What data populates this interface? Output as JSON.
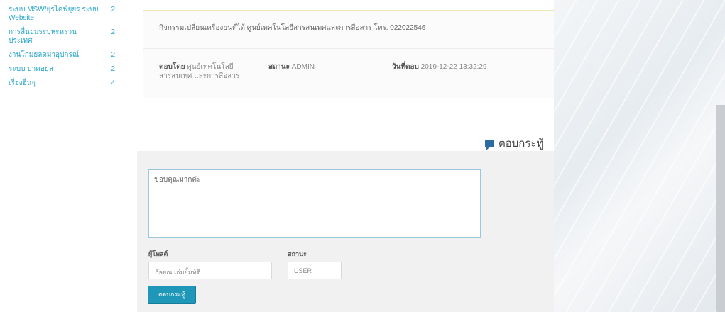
{
  "sidebar": {
    "items": [
      {
        "label": "ระบบ MSW/ยุรไคฟ์ยุยร  ระบบ Website",
        "count": "2"
      },
      {
        "label": "การลื่นยมระบุหะหร่วน ประเทศ",
        "count": "2"
      },
      {
        "label": "งานโกมยลดมาอุปกรณ์",
        "count": "2"
      },
      {
        "label": "ระบบ บาคอยุล",
        "count": "2"
      },
      {
        "label": "เรื่องอื่นๆ",
        "count": "4"
      }
    ]
  },
  "comment": {
    "message": "กิจกรรมเปลี่ยนเครื่องยนต์ได้ ศูนย์เทคโนโลยีสารสนเทศและการสื่อสาร โทร. 022022546",
    "author_label": "ตอบโดย",
    "author_value": "ศูนย์เทคโนโลยีสารสนเทศ และการสื่อสาร",
    "status_label": "สถานะ",
    "status_value": "ADMIN",
    "date_label": "วันที่ตอบ",
    "date_value": "2019-12-22 13:32:29"
  },
  "reply": {
    "heading": "ตอบกระทู้",
    "textarea_value": "ขอบคุณมากค่ะ",
    "responder_label": "ผู้โพสต์",
    "responder_value": "กัลยณ เอ่มยิ้มท์ดี",
    "status_label": "สถานะ",
    "status_value": "USER",
    "submit_label": "ตอบกระทู้"
  }
}
